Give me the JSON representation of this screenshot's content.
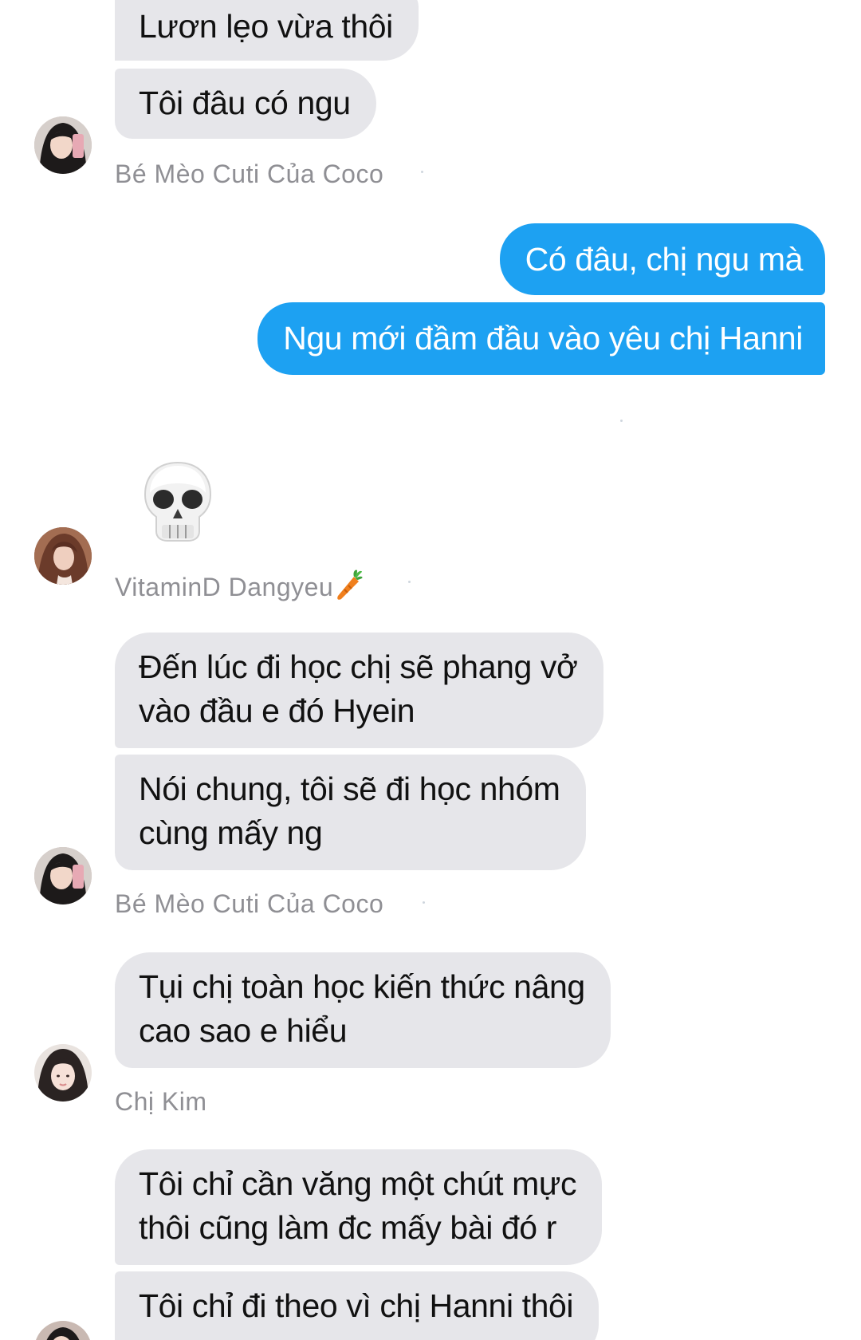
{
  "colors": {
    "incoming_bubble": "#e6e6ea",
    "outgoing_bubble": "#1da1f2",
    "sender_name": "#8f8f94",
    "background": "#ffffff"
  },
  "messages": {
    "m1": "Lươn lẹo vừa thôi",
    "m2": "Tôi đâu có ngu",
    "m3": "Có đâu, chị ngu mà",
    "m4": "Ngu mới đầm đầu vào yêu chị Hanni",
    "m5_icon": "skull-emoji",
    "m6_line1": "Đến lúc đi học chị sẽ phang vở",
    "m6_line2": "vào đầu e đó Hyein",
    "m7_line1": "Nói chung, tôi sẽ đi học nhóm",
    "m7_line2": "cùng mấy ng",
    "m8_line1": "Tụi chị toàn học kiến thức nâng",
    "m8_line2": "cao sao e hiểu",
    "m9_line1": "Tôi chỉ cần văng một chút mực",
    "m9_line2": "thôi cũng làm đc mấy bài đó r",
    "m10": "Tôi chỉ đi theo vì chị Hanni thôi"
  },
  "senders": {
    "s1": "Bé Mèo Cuti Của Coco",
    "s2": "VitaminD Dangyeu",
    "s2_emoji_icon": "carrot-emoji",
    "s3": "Bé Mèo Cuti Của Coco",
    "s4": "Chị Kim"
  },
  "avatars": {
    "a1": "avatar-photo",
    "a2": "avatar-photo",
    "a3": "avatar-photo",
    "a4": "avatar-photo",
    "a5": "avatar-photo"
  }
}
